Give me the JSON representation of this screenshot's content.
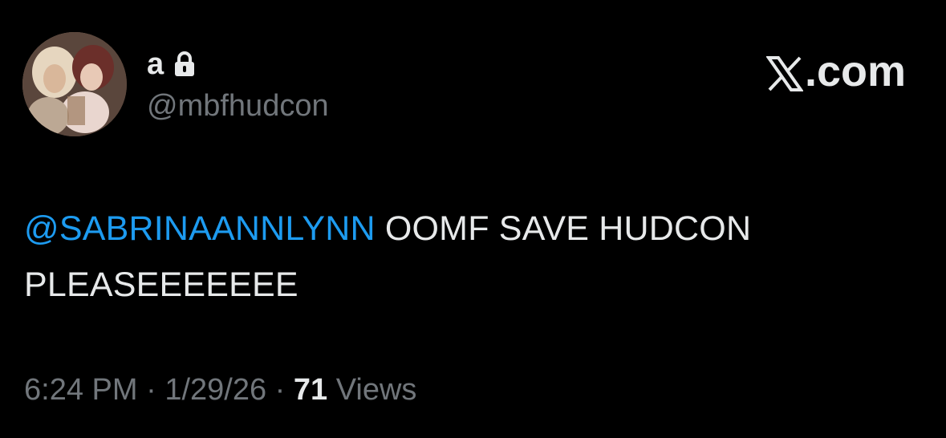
{
  "profile": {
    "display_name": "a",
    "handle": "@mbfhudcon",
    "avatar_icon": "profile-photo"
  },
  "header": {
    "site_label": ".com",
    "logo_icon": "x-logo-icon"
  },
  "tweet": {
    "mention": "@SABRINAANNLYNN",
    "body": " OOMF SAVE HUDCON PLEASEEEEEEE"
  },
  "meta": {
    "time": "6:24 PM",
    "separator": " · ",
    "date": "1/29/26",
    "views_count": "71",
    "views_label": " Views"
  },
  "colors": {
    "background": "#000000",
    "text_primary": "#e7e9ea",
    "text_secondary": "#71767b",
    "mention": "#1d9bf0"
  }
}
